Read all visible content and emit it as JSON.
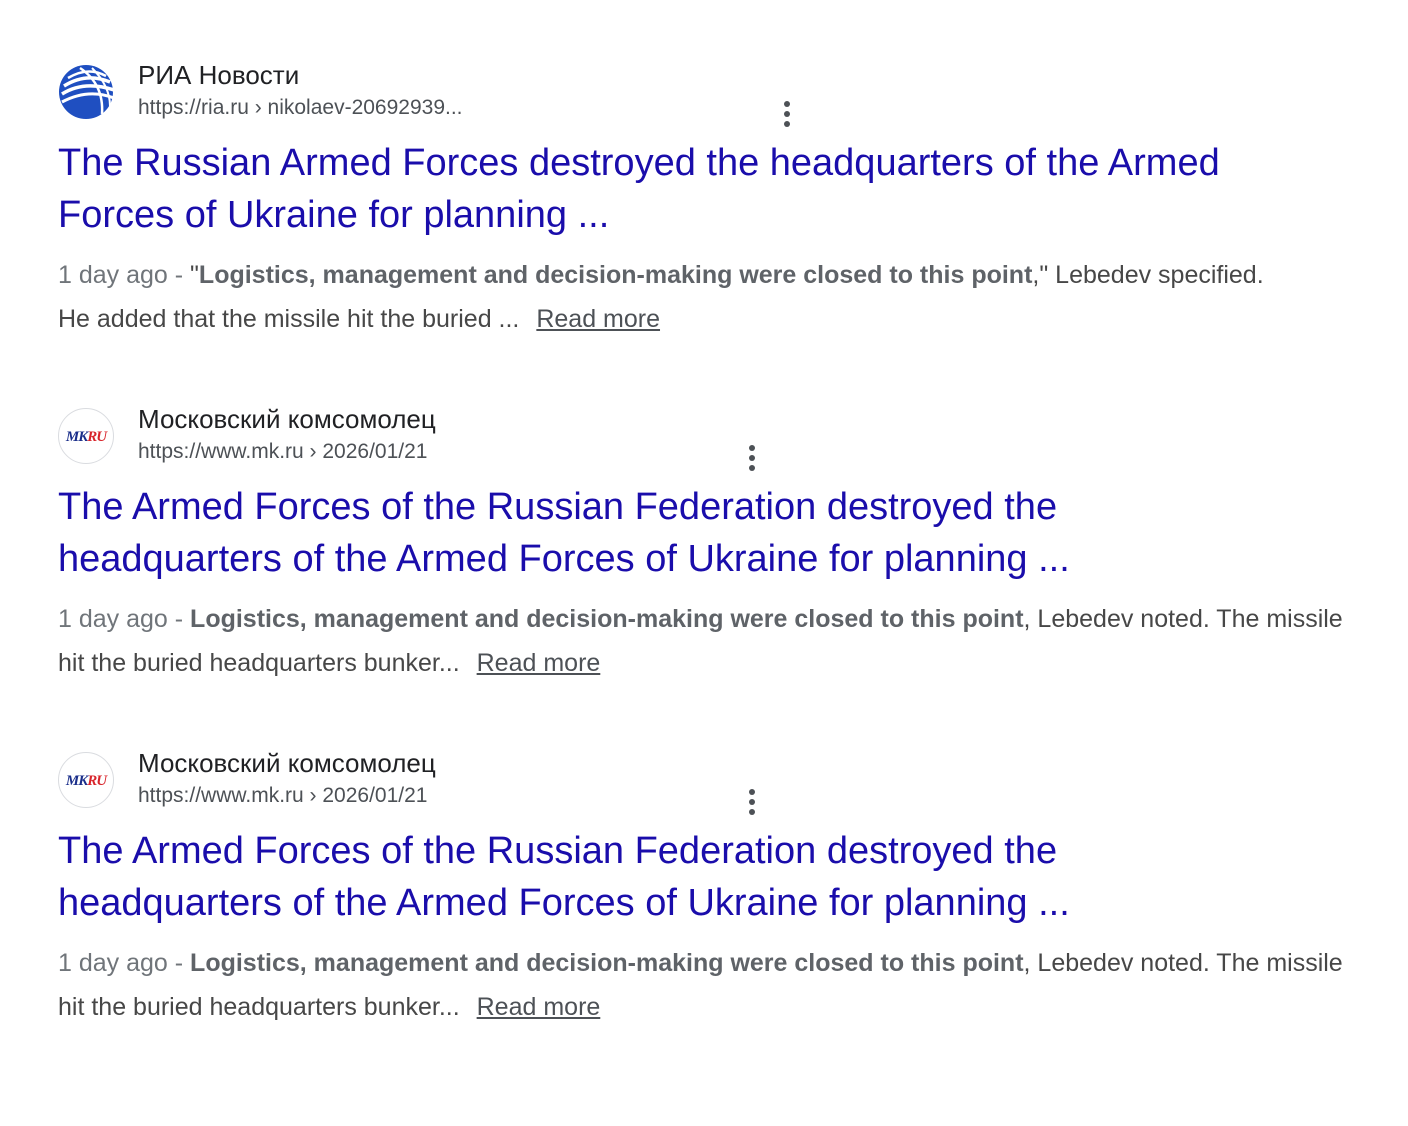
{
  "results": [
    {
      "site_name": "РИА Новости",
      "url": "https://ria.ru › nikolaev-20692939...",
      "favicon": "ria-globe-icon",
      "title_line1": "The Russian Armed Forces destroyed the headquarters of the Armed",
      "title_line2": "Forces of Ukraine for planning ...",
      "date": "1 day ago",
      "separator": " - ",
      "snippet_pre": "\"",
      "snippet_bold": "Logistics, management and decision-making were closed to this point",
      "snippet_post": ",\" Lebedev specified. He added that the missile hit the buried ...",
      "read_more": "Read more"
    },
    {
      "site_name": "Московский комсомолец",
      "url": "https://www.mk.ru › 2026/01/21",
      "favicon": "mkru-logo-icon",
      "logo_text": "MKRU",
      "title_line1": "The Armed Forces of the Russian Federation destroyed the",
      "title_line2": "headquarters of the Armed Forces of Ukraine for planning ...",
      "date": "1 day ago",
      "separator": " - ",
      "snippet_pre": "",
      "snippet_bold": "Logistics, management and decision-making were closed to this point",
      "snippet_post": ", Lebedev noted. The missile hit the buried headquarters bunker...",
      "read_more": "Read more"
    },
    {
      "site_name": "Московский комсомолец",
      "url": "https://www.mk.ru › 2026/01/21",
      "favicon": "mkru-logo-icon",
      "logo_text": "MKRU",
      "title_line1": "The Armed Forces of the Russian Federation destroyed the",
      "title_line2": "headquarters of the Armed Forces of Ukraine for planning ...",
      "date": "1 day ago",
      "separator": " - ",
      "snippet_pre": "",
      "snippet_bold": "Logistics, management and decision-making were closed to this point",
      "snippet_post": ", Lebedev noted. The missile hit the buried headquarters bunker...",
      "read_more": "Read more"
    }
  ],
  "colors": {
    "title_link": "#1a0dab",
    "site_name": "#202124",
    "url": "#4d5156",
    "snippet": "#474747",
    "ria_blue": "#1f4fc1"
  }
}
